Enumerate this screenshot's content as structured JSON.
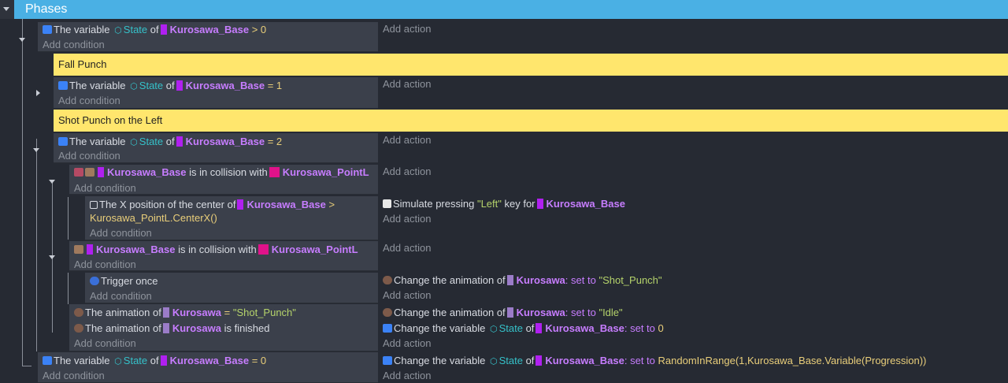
{
  "group": {
    "title": "Phases"
  },
  "labels": {
    "add_condition": "Add condition",
    "add_action": "Add action"
  },
  "colors": {
    "header": "#4ab0e4",
    "comment": "#ffe66d",
    "object": "#c77dff",
    "variable": "#35c1c9"
  },
  "ev1": {
    "c1": {
      "a": "The variable",
      "var": "State",
      "of": "of",
      "obj": "Kurosawa_Base",
      "op": ">",
      "val": "0"
    }
  },
  "comment1": "Fall Punch",
  "ev2": {
    "c1": {
      "a": "The variable",
      "var": "State",
      "of": "of",
      "obj": "Kurosawa_Base",
      "op": "=",
      "val": "1"
    }
  },
  "comment2": "Shot Punch on the Left",
  "ev3": {
    "c1": {
      "a": "The variable",
      "var": "State",
      "of": "of",
      "obj": "Kurosawa_Base",
      "op": "=",
      "val": "2"
    }
  },
  "ev4": {
    "c1": {
      "obj1": "Kurosawa_Base",
      "mid": "is in collision with",
      "obj2": "Kurosawa_PointL"
    }
  },
  "ev5": {
    "c1": {
      "a": "The X position of the center of",
      "obj": "Kurosawa_Base",
      "op": ">",
      "expr": "Kurosawa_PointL.CenterX()"
    },
    "a1": {
      "a": "Simulate pressing",
      "key": "\"Left\"",
      "b": "key for",
      "obj": "Kurosawa_Base"
    }
  },
  "ev6": {
    "c1": {
      "obj1": "Kurosawa_Base",
      "mid": "is in collision with",
      "obj2": "Kurosawa_PointL"
    }
  },
  "ev7": {
    "c1": {
      "a": "Trigger once"
    },
    "a1": {
      "a": "Change the animation of",
      "obj": "Kurosawa",
      "b": ": set to",
      "val": "\"Shot_Punch\""
    }
  },
  "ev8": {
    "c1": {
      "a": "The animation of",
      "obj": "Kurosawa",
      "op": "=",
      "val": "\"Shot_Punch\""
    },
    "c2": {
      "a": "The animation of",
      "obj": "Kurosawa",
      "b": "is finished"
    },
    "a1": {
      "a": "Change the animation of",
      "obj": "Kurosawa",
      "b": ": set to",
      "val": "\"Idle\""
    },
    "a2": {
      "a": "Change the variable",
      "var": "State",
      "of": "of",
      "obj": "Kurosawa_Base",
      "b": ": set to",
      "val": "0"
    }
  },
  "ev9": {
    "c1": {
      "a": "The variable",
      "var": "State",
      "of": "of",
      "obj": "Kurosawa_Base",
      "op": "=",
      "val": "0"
    },
    "a1": {
      "a": "Change the variable",
      "var": "State",
      "of": "of",
      "obj": "Kurosawa_Base",
      "b": ": set to",
      "val": "RandomInRange(1,Kurosawa_Base.Variable(Progression))"
    }
  }
}
